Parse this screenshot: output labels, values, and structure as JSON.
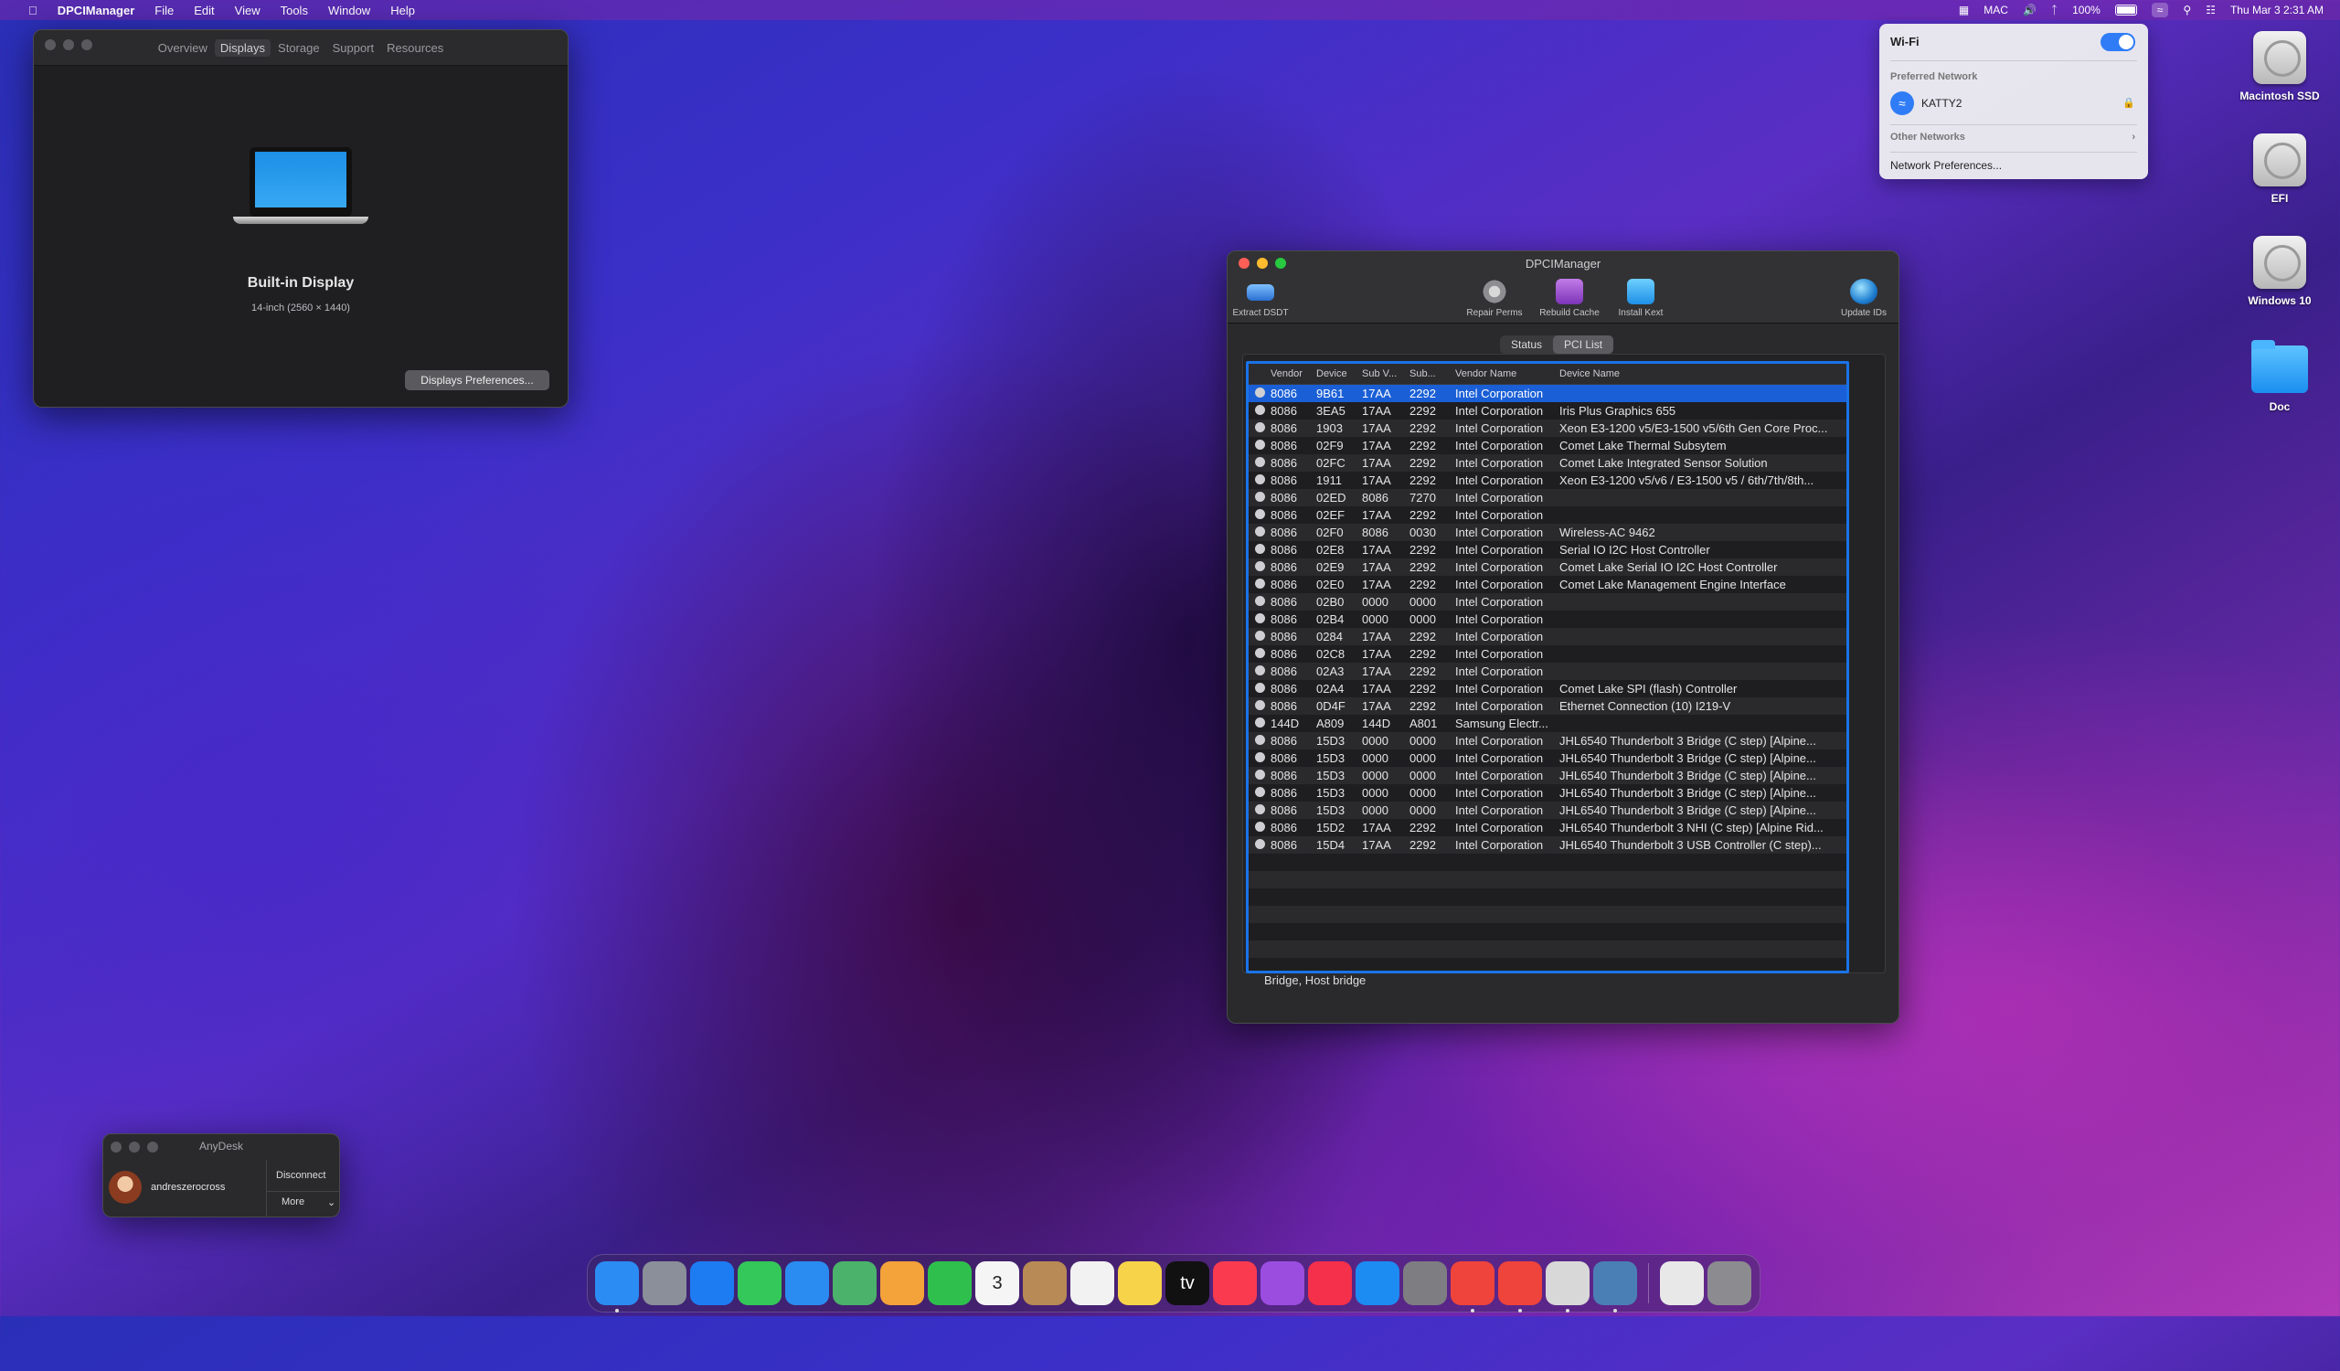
{
  "menubar": {
    "app_name": "DPCIManager",
    "items": [
      "File",
      "Edit",
      "View",
      "Tools",
      "Window",
      "Help"
    ],
    "right": {
      "user": "MAC",
      "battery": "100%",
      "datetime": "Thu Mar 3  2:31 AM"
    }
  },
  "wifi_menu": {
    "title": "Wi-Fi",
    "enabled": true,
    "preferred_label": "Preferred Network",
    "network_name": "KATTY2",
    "other_label": "Other Networks",
    "prefs_label": "Network Preferences..."
  },
  "desktop_icons": [
    {
      "label": "Macintosh SSD",
      "kind": "disk"
    },
    {
      "label": "EFI",
      "kind": "disk"
    },
    {
      "label": "Windows 10",
      "kind": "disk"
    },
    {
      "label": "Doc",
      "kind": "folder"
    }
  ],
  "about_window": {
    "tabs": [
      "Overview",
      "Displays",
      "Storage",
      "Support",
      "Resources"
    ],
    "selected_tab": "Displays",
    "display_name": "Built-in Display",
    "display_detail": "14-inch (2560 × 1440)",
    "button": "Displays Preferences..."
  },
  "dpci": {
    "title": "DPCIManager",
    "toolbar": {
      "extract": "Extract DSDT",
      "repair": "Repair Perms",
      "rebuild": "Rebuild Cache",
      "install": "Install Kext",
      "update": "Update IDs"
    },
    "segments": [
      "Status",
      "PCI List"
    ],
    "active_segment": "PCI List",
    "columns": [
      "Vendor",
      "Device",
      "Sub V...",
      "Sub...",
      "Vendor Name",
      "Device Name"
    ],
    "rows": [
      [
        "8086",
        "9B61",
        "17AA",
        "2292",
        "Intel Corporation",
        ""
      ],
      [
        "8086",
        "3EA5",
        "17AA",
        "2292",
        "Intel Corporation",
        "Iris Plus Graphics 655"
      ],
      [
        "8086",
        "1903",
        "17AA",
        "2292",
        "Intel Corporation",
        "Xeon E3-1200 v5/E3-1500 v5/6th Gen Core Proc..."
      ],
      [
        "8086",
        "02F9",
        "17AA",
        "2292",
        "Intel Corporation",
        "Comet Lake Thermal Subsytem"
      ],
      [
        "8086",
        "02FC",
        "17AA",
        "2292",
        "Intel Corporation",
        "Comet Lake Integrated Sensor Solution"
      ],
      [
        "8086",
        "1911",
        "17AA",
        "2292",
        "Intel Corporation",
        "Xeon E3-1200 v5/v6 / E3-1500 v5 / 6th/7th/8th..."
      ],
      [
        "8086",
        "02ED",
        "8086",
        "7270",
        "Intel Corporation",
        ""
      ],
      [
        "8086",
        "02EF",
        "17AA",
        "2292",
        "Intel Corporation",
        ""
      ],
      [
        "8086",
        "02F0",
        "8086",
        "0030",
        "Intel Corporation",
        "Wireless-AC 9462"
      ],
      [
        "8086",
        "02E8",
        "17AA",
        "2292",
        "Intel Corporation",
        "Serial IO I2C Host Controller"
      ],
      [
        "8086",
        "02E9",
        "17AA",
        "2292",
        "Intel Corporation",
        "Comet Lake Serial IO I2C Host Controller"
      ],
      [
        "8086",
        "02E0",
        "17AA",
        "2292",
        "Intel Corporation",
        "Comet Lake Management Engine Interface"
      ],
      [
        "8086",
        "02B0",
        "0000",
        "0000",
        "Intel Corporation",
        ""
      ],
      [
        "8086",
        "02B4",
        "0000",
        "0000",
        "Intel Corporation",
        ""
      ],
      [
        "8086",
        "0284",
        "17AA",
        "2292",
        "Intel Corporation",
        ""
      ],
      [
        "8086",
        "02C8",
        "17AA",
        "2292",
        "Intel Corporation",
        ""
      ],
      [
        "8086",
        "02A3",
        "17AA",
        "2292",
        "Intel Corporation",
        ""
      ],
      [
        "8086",
        "02A4",
        "17AA",
        "2292",
        "Intel Corporation",
        "Comet Lake SPI (flash) Controller"
      ],
      [
        "8086",
        "0D4F",
        "17AA",
        "2292",
        "Intel Corporation",
        "Ethernet Connection (10) I219-V"
      ],
      [
        "144D",
        "A809",
        "144D",
        "A801",
        "Samsung Electr...",
        ""
      ],
      [
        "8086",
        "15D3",
        "0000",
        "0000",
        "Intel Corporation",
        "JHL6540 Thunderbolt 3 Bridge (C step) [Alpine..."
      ],
      [
        "8086",
        "15D3",
        "0000",
        "0000",
        "Intel Corporation",
        "JHL6540 Thunderbolt 3 Bridge (C step) [Alpine..."
      ],
      [
        "8086",
        "15D3",
        "0000",
        "0000",
        "Intel Corporation",
        "JHL6540 Thunderbolt 3 Bridge (C step) [Alpine..."
      ],
      [
        "8086",
        "15D3",
        "0000",
        "0000",
        "Intel Corporation",
        "JHL6540 Thunderbolt 3 Bridge (C step) [Alpine..."
      ],
      [
        "8086",
        "15D3",
        "0000",
        "0000",
        "Intel Corporation",
        "JHL6540 Thunderbolt 3 Bridge (C step) [Alpine..."
      ],
      [
        "8086",
        "15D2",
        "17AA",
        "2292",
        "Intel Corporation",
        "JHL6540 Thunderbolt 3 NHI (C step) [Alpine Rid..."
      ],
      [
        "8086",
        "15D4",
        "17AA",
        "2292",
        "Intel Corporation",
        "JHL6540 Thunderbolt 3 USB Controller (C step)..."
      ]
    ],
    "selected_row": 0,
    "status_line": "Bridge, Host bridge"
  },
  "anydesk": {
    "title": "AnyDesk",
    "user": "andreszerocross",
    "disconnect": "Disconnect",
    "more": "More"
  },
  "dock": {
    "apps": [
      {
        "name": "finder-icon",
        "color": "#2b8cf3",
        "running": true
      },
      {
        "name": "launchpad-icon",
        "color": "#8a8f99",
        "running": false
      },
      {
        "name": "safari-icon",
        "color": "#1e7cf2",
        "running": false
      },
      {
        "name": "messages-icon",
        "color": "#34c759",
        "running": false
      },
      {
        "name": "mail-icon",
        "color": "#2a8cf0",
        "running": false
      },
      {
        "name": "maps-icon",
        "color": "#4bb26b",
        "running": false
      },
      {
        "name": "photos-icon",
        "color": "#f4a23a",
        "running": false
      },
      {
        "name": "facetime-icon",
        "color": "#2fbf4d",
        "running": false
      },
      {
        "name": "calendar-icon",
        "color": "#f5f5f5",
        "running": false,
        "text": "3"
      },
      {
        "name": "contacts-icon",
        "color": "#b88a55",
        "running": false
      },
      {
        "name": "reminders-icon",
        "color": "#f2f2f2",
        "running": false
      },
      {
        "name": "notes-icon",
        "color": "#f7d34a",
        "running": false
      },
      {
        "name": "tv-icon",
        "color": "#111111",
        "running": false,
        "text": "tv"
      },
      {
        "name": "music-icon",
        "color": "#fa3b4f",
        "running": false
      },
      {
        "name": "podcasts-icon",
        "color": "#9b4de0",
        "running": false
      },
      {
        "name": "news-icon",
        "color": "#f5304a",
        "running": false
      },
      {
        "name": "app-store-icon",
        "color": "#1c8bf2",
        "running": false
      },
      {
        "name": "system-preferences-icon",
        "color": "#7d7d82",
        "running": false
      },
      {
        "name": "anydesk-icon",
        "color": "#ef443b",
        "running": true
      },
      {
        "name": "anydesk-alt-icon",
        "color": "#ef443b",
        "running": true
      },
      {
        "name": "script-editor-icon",
        "color": "#d8d8d8",
        "running": true
      },
      {
        "name": "dpcimanager-icon",
        "color": "#4a7fb5",
        "running": true
      }
    ],
    "right": [
      {
        "name": "document-icon",
        "color": "#e8e8e8"
      },
      {
        "name": "trash-icon",
        "color": "#8c8c90"
      }
    ]
  }
}
